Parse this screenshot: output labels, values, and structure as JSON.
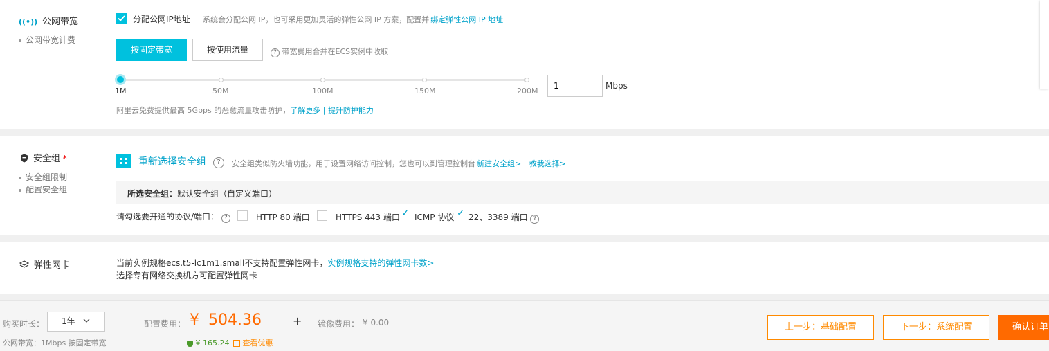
{
  "bandwidth": {
    "nav_title": "公网带宽",
    "nav_sub": "公网带宽计费",
    "assign_ip_label": "分配公网IP地址",
    "assign_ip_checked": true,
    "assign_ip_desc": "系统会分配公网 IP，也可采用更加灵活的弹性公网 IP 方案，配置并",
    "assign_ip_link": "绑定弹性公网 IP 地址",
    "btn_fixed": "按固定带宽",
    "btn_traffic": "按使用流量",
    "billing_note": "带宽费用合并在ECS实例中收取",
    "slider_ticks": [
      "1M",
      "50M",
      "100M",
      "150M",
      "200M"
    ],
    "slider_value": 1,
    "input_value": "1",
    "unit": "Mbps",
    "ddos_text": "阿里云免费提供最高 5Gbps 的恶意流量攻击防护，",
    "ddos_link1": "了解更多",
    "ddos_sep": "|",
    "ddos_link2": "提升防护能力"
  },
  "security": {
    "nav_title": "安全组",
    "required_mark": "*",
    "nav_sub": [
      "安全组限制",
      "配置安全组"
    ],
    "reselect_label": "重新选择安全组",
    "desc": "安全组类似防火墙功能，用于设置网络访问控制，您也可以到管理控制台",
    "link_new": "新建安全组>",
    "link_help": "教我选择>",
    "selected_label": "所选安全组：",
    "selected_value": "默认安全组（自定义端口）",
    "ports_label": "请勾选要开通的协议/端口：",
    "ports": [
      {
        "label": "HTTP 80 端口",
        "checked": false
      },
      {
        "label": "HTTPS 443 端口",
        "checked": false
      },
      {
        "label": "ICMP 协议",
        "checked": true
      },
      {
        "label": "22、3389 端口",
        "checked": true
      }
    ]
  },
  "eni": {
    "nav_title": "弹性网卡",
    "line1": "当前实例规格ecs.t5-lc1m1.small不支持配置弹性网卡，",
    "line1_link": "实例规格支持的弹性网卡数>",
    "line2": "选择专有网络交换机方可配置弹性网卡"
  },
  "footer": {
    "duration_label": "购买时长：",
    "duration_value": "1年",
    "bandwidth_summary": "公网带宽：1Mbps 按固定带宽",
    "config_fee_label": "配置费用：",
    "currency": "¥",
    "config_fee": "504.36",
    "plus": "+",
    "saving_currency": "¥",
    "saving": "165.24",
    "discount_link": "查看优惠",
    "image_fee_label": "镜像费用：",
    "image_fee": "¥ 0.00",
    "btn_prev": "上一步：基础配置",
    "btn_next": "下一步：系统配置",
    "btn_confirm": "确认订单"
  },
  "colors": {
    "accent": "#00c1de",
    "link": "#00a2ca",
    "orange": "#ff6a00"
  }
}
